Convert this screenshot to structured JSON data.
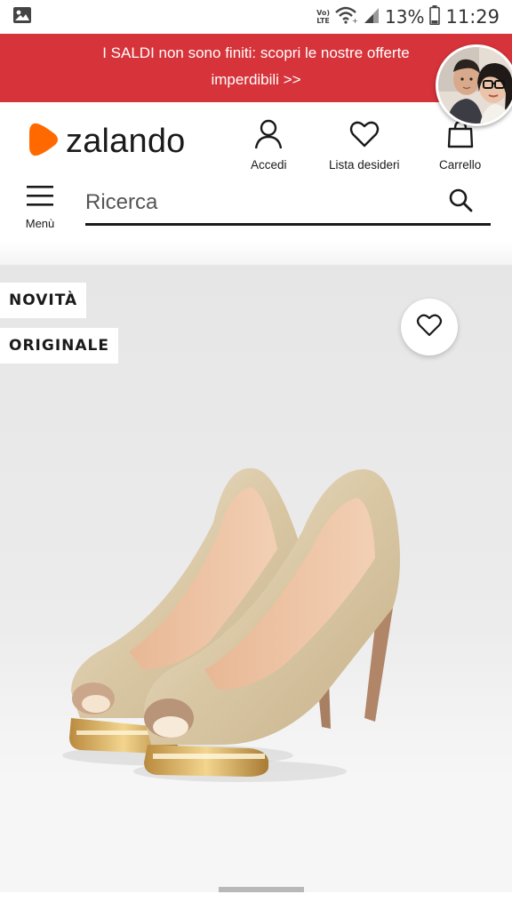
{
  "status_bar": {
    "network": "Vo) LTE",
    "battery": "13%",
    "time": "11:29"
  },
  "promo": {
    "line1": "I SALDI non sono finiti: scopri le nostre offerte",
    "line2": "imperdibili >>",
    "color": "#d6333a"
  },
  "header": {
    "brand": "zalando",
    "brand_color": "#ff6900",
    "actions": {
      "login": "Accedi",
      "wishlist": "Lista desideri",
      "cart": "Carrello"
    }
  },
  "search": {
    "menu_label": "Menù",
    "placeholder": "Ricerca"
  },
  "product": {
    "badges": [
      "NOVITÀ",
      "ORIGINALE"
    ],
    "image": "gold-glitter-peep-toe-pumps"
  },
  "icons": [
    "gallery-icon",
    "wifi-icon",
    "signal-icon",
    "battery-icon",
    "user-icon",
    "heart-icon",
    "bag-icon",
    "hamburger-icon",
    "search-icon"
  ]
}
